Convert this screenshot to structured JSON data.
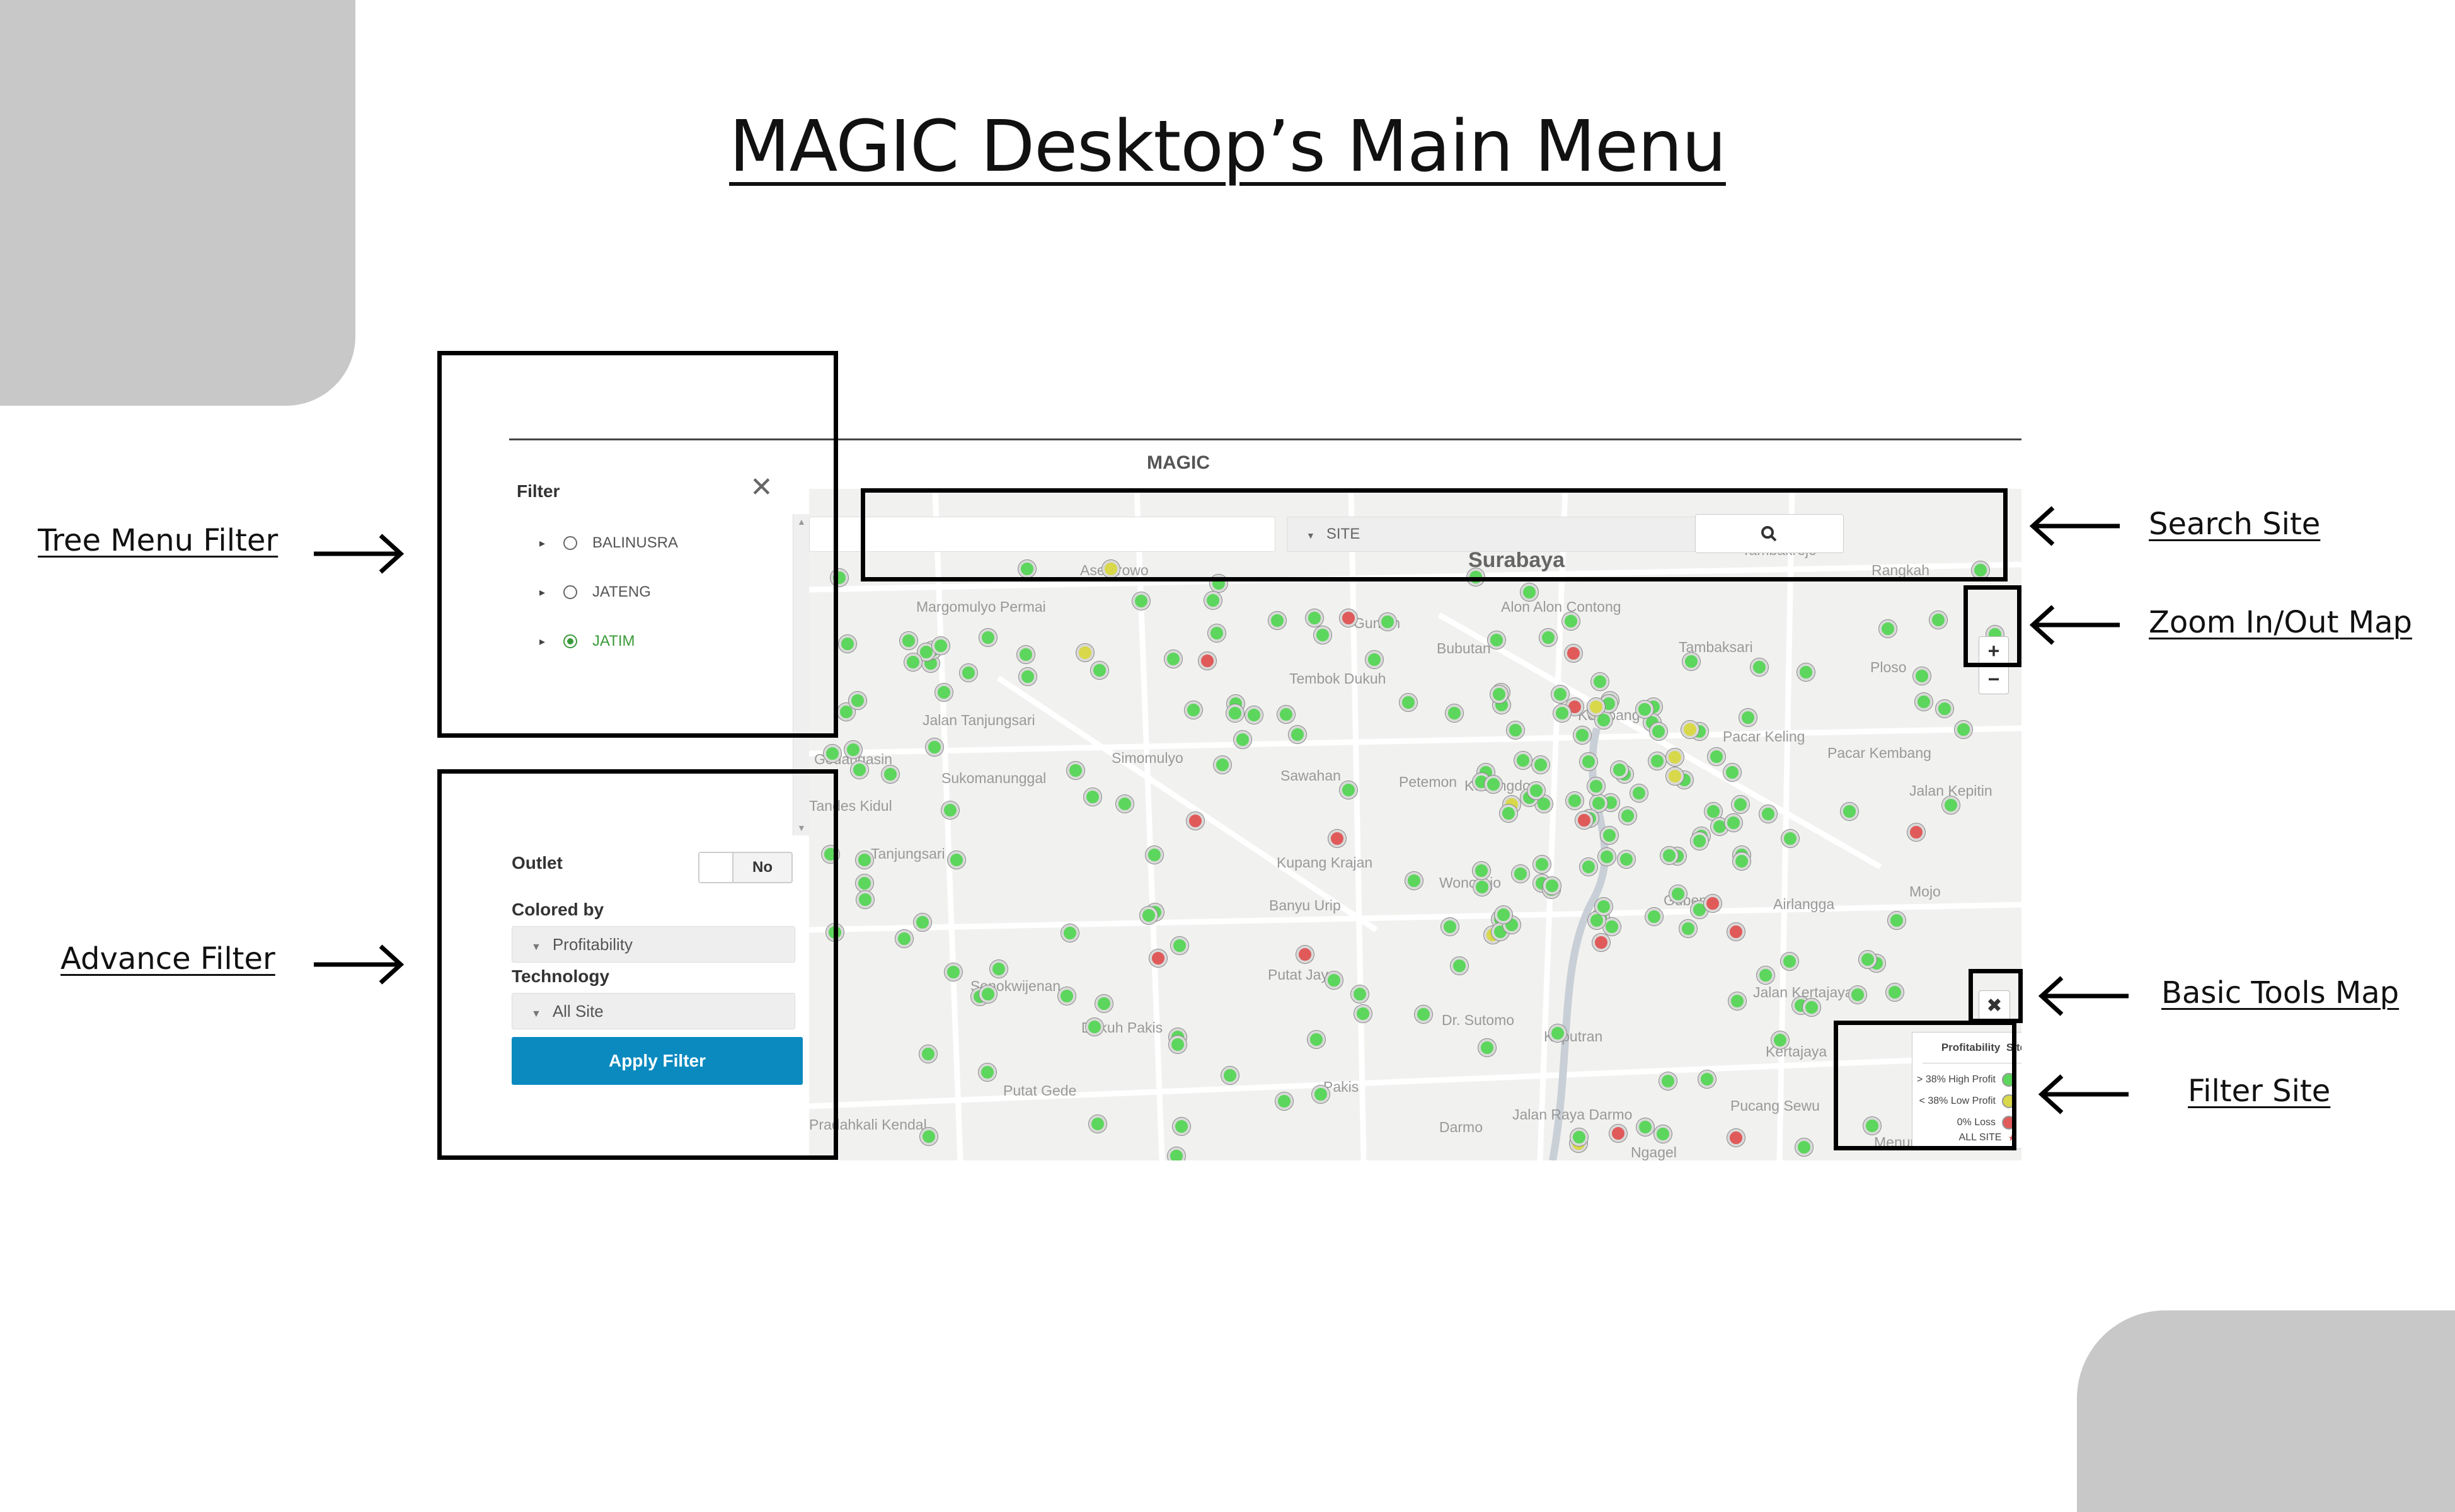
{
  "slide": {
    "title": "MAGIC Desktop’s Main Menu",
    "annotations": {
      "tree_menu_filter": "Tree Menu Filter",
      "advance_filter": "Advance Filter",
      "search_site": "Search Site",
      "zoom_map": "Zoom In/Out Map",
      "basic_tools_map": "Basic Tools Map",
      "filter_site": "Filter Site"
    }
  },
  "app": {
    "title": "MAGIC",
    "filter_panel": {
      "header": "Filter",
      "close_icon": "close-icon",
      "tree": [
        {
          "label": "BALINUSRA",
          "selected": false
        },
        {
          "label": "JATENG",
          "selected": false
        },
        {
          "label": "JATIM",
          "selected": true
        }
      ]
    },
    "advance_filter": {
      "outlet_label": "Outlet",
      "outlet_value": "No",
      "colored_by_label": "Colored by",
      "colored_by_value": "Profitability",
      "technology_label": "Technology",
      "technology_value": "All Site",
      "apply_label": "Apply Filter"
    },
    "search": {
      "input_value": "",
      "type_value": "SITE",
      "button_icon": "search-icon"
    },
    "zoom": {
      "in_label": "+",
      "out_label": "−"
    },
    "tools_icon": "tools-icon",
    "legend": {
      "header_profit": "Profitability",
      "header_site": "Site",
      "items": [
        {
          "label": "> 38% High Profit",
          "color": "#5cd65c",
          "checked": true
        },
        {
          "label": "< 38% Low Profit",
          "color": "#d8d84a",
          "checked": true
        },
        {
          "label": "0% Loss",
          "color": "#e05a5a",
          "checked": true
        },
        {
          "label": "ALL SITE",
          "color": "#e05a5a",
          "checked": false
        }
      ]
    },
    "map_labels": [
      "Surabaya",
      "Tambakrejo",
      "Rangkah",
      "Asemrowo",
      "Margomulyo Permai",
      "Gundih",
      "Alon Alon Contong",
      "Bubutan",
      "Tembok Dukuh",
      "Tambaksari",
      "Ploso",
      "Jalan Tanjungsari",
      "Simomulyo",
      "Ketabang",
      "Pacar Keling",
      "Pacar Kembang",
      "Gedangasin",
      "Sukomanunggal",
      "Sawahan",
      "Petemon",
      "Kedungdoro",
      "Jalan Kepitin",
      "Tandes Kidul",
      "Tanjungsari",
      "Kupang Krajan",
      "Wonorejo",
      "Gubeng",
      "Airlangga",
      "Mojo",
      "Banyu Urip",
      "Putat Jaya",
      "Sonokwijenan",
      "Dukuh Pakis",
      "Dr. Sutomo",
      "Keputran",
      "Jalan Kertajaya",
      "Pakis",
      "Putat Gede",
      "Darmo",
      "Pucang Sewu",
      "Pradahkali Kendal",
      "Menur",
      "Jalan Raya Darmo",
      "Ngagel",
      "Kertajaya"
    ],
    "colors": {
      "high": "#5cd65c",
      "low": "#d8d84a",
      "loss": "#e05a5a",
      "button": "#0a8abf"
    }
  }
}
